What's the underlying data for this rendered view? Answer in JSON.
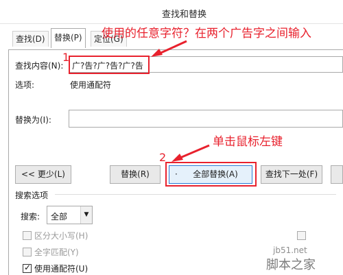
{
  "window": {
    "title": "查找和替换"
  },
  "tabs": [
    {
      "label": "查找(D)"
    },
    {
      "label": "替换(P)"
    },
    {
      "label": "定位(G)"
    }
  ],
  "find": {
    "label": "查找内容(N):",
    "value": "广?告?广?告?广?告",
    "options_label": "选项:",
    "options_value": "使用通配符"
  },
  "replace": {
    "label": "替换为(I):",
    "value": ""
  },
  "buttons": {
    "less": "<< 更少(L)",
    "replace": "替换(R)",
    "replace_all": "全部替换(A)",
    "find_next": "查找下一处(F)"
  },
  "search_options": {
    "section_label": "搜索选项",
    "search_label": "搜索:",
    "search_value": "全部",
    "match_case": "区分大小写(H)",
    "whole_word": "全字匹配(Y)",
    "wildcards": "使用通配符(U)"
  },
  "annotations": {
    "n1": "1",
    "n2": "2",
    "wildcard_hint": "使用的任意字符？在两个广告字之间输入",
    "click_hint": "单击鼠标左键"
  },
  "watermark": {
    "site": "jb51.net",
    "brand": "脚本之家"
  },
  "colors": {
    "annotation_red": "#e8212d",
    "primary_border": "#2b7bd6"
  }
}
